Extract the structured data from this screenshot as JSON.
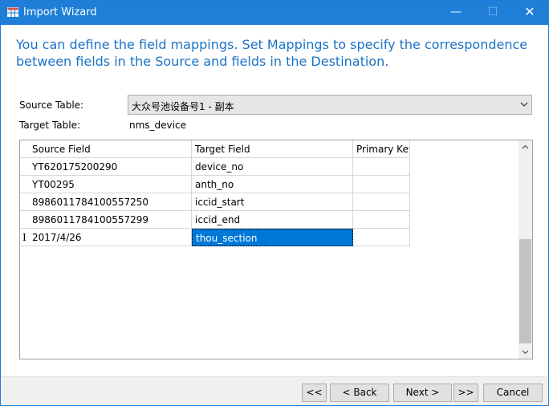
{
  "window": {
    "title": "Import Wizard",
    "controls": {
      "minimize": "—",
      "maximize": "☐",
      "close": "✕"
    }
  },
  "heading": "You can define the field mappings. Set Mappings to specify the correspondence between fields in the Source and fields in the Destination.",
  "source_table": {
    "label": "Source Table:",
    "value": "大众号池设备号1 - 副本"
  },
  "target_table": {
    "label": "Target Table:",
    "value": "nms_device"
  },
  "grid": {
    "columns": [
      "Source Field",
      "Target Field",
      "Primary Key"
    ],
    "rows": [
      {
        "source": "YT620175200290",
        "target": "device_no",
        "primary_key": ""
      },
      {
        "source": "YT00295",
        "target": "anth_no",
        "primary_key": ""
      },
      {
        "source": "8986011784100557250",
        "target": "iccid_start",
        "primary_key": ""
      },
      {
        "source": "8986011784100557299",
        "target": "iccid_end",
        "primary_key": ""
      },
      {
        "source": "2017/4/26",
        "target": "thou_section",
        "primary_key": ""
      }
    ],
    "current_row_indicator": "I"
  },
  "buttons": {
    "first": "<<",
    "back": "< Back",
    "next": "Next >",
    "last": ">>",
    "cancel": "Cancel"
  },
  "colors": {
    "titlebar": "#1e7ed8",
    "heading": "#1a72c6",
    "selection": "#0078d7"
  }
}
